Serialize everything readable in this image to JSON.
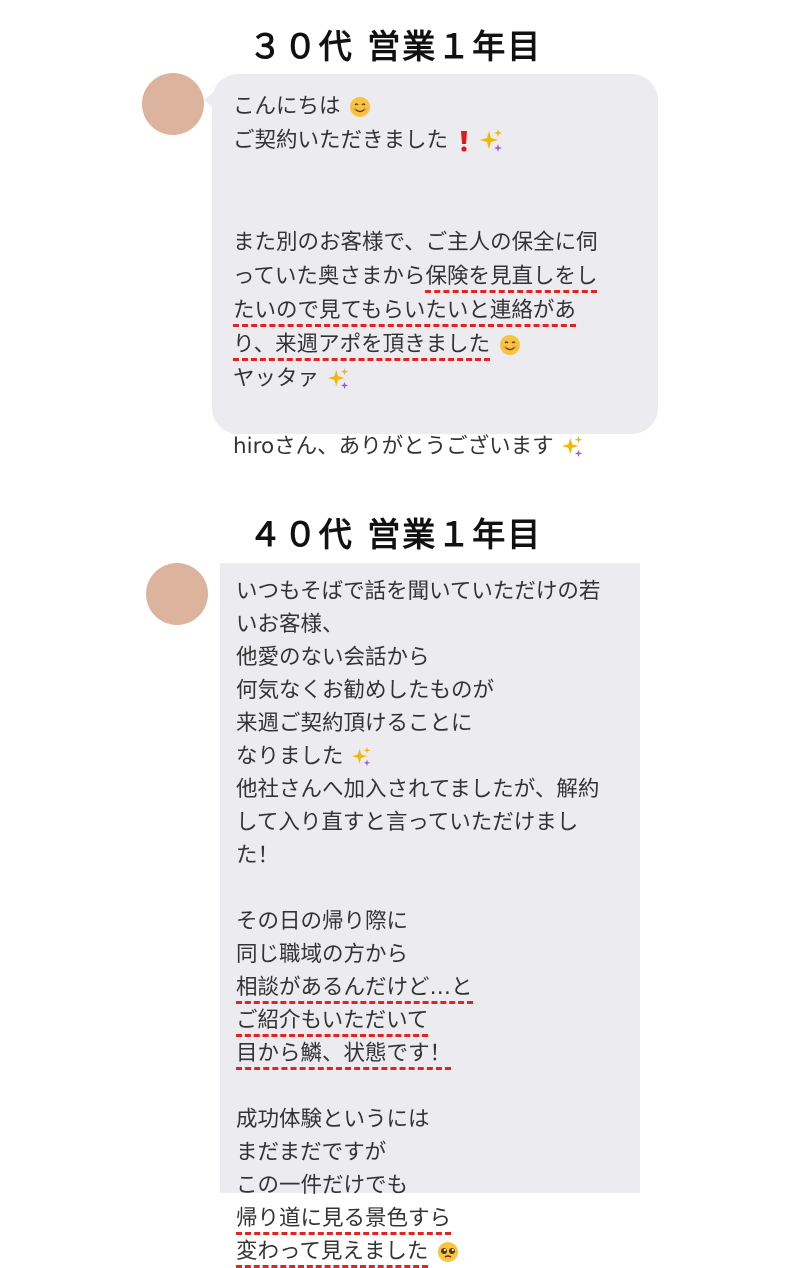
{
  "sections": [
    {
      "heading": "３０代 営業１年目",
      "message": {
        "l1": "こんにちは",
        "l2": "ご契約いただきました",
        "l3": "また別のお客様で、ご主人の保全に伺",
        "l4a": "っていた奥さまから",
        "l4b": "保険を見直しをし",
        "l5": "たいので見てもらいたいと連絡があ",
        "l6": "り、来週アポを頂きました",
        "l7": "ヤッタァ",
        "l8": "hiroさん、ありがとうございます"
      }
    },
    {
      "heading": "４０代 営業１年目",
      "message": {
        "l1": "いつもそばで話を聞いていただけの若",
        "l2": "いお客様、",
        "l3": "他愛のない会話から",
        "l4": "何気なくお勧めしたものが",
        "l5": "来週ご契約頂けることに",
        "l6": "なりました",
        "l7": "他社さんへ加入されてましたが、解約",
        "l8": "して入り直すと言っていただけまし",
        "l9": "た！",
        "l10": "その日の帰り際に",
        "l11": "同じ職域の方から",
        "l12": "相談があるんだけど…と",
        "l13": "ご紹介もいただいて",
        "l14": "目から鱗、状態です！",
        "l15": "成功体験というには",
        "l16": "まだまだですが",
        "l17": "この一件だけでも",
        "l18": "帰り道に見る景色すら",
        "l19": "変わって見えました"
      }
    }
  ],
  "icons": [
    "smiling-face-emoji",
    "exclamation-emoji",
    "sparkles-emoji",
    "pleading-face-emoji"
  ],
  "colors": {
    "bubble": "#ececf0",
    "underline": "#e32222",
    "avatar": "#dcb49d"
  }
}
